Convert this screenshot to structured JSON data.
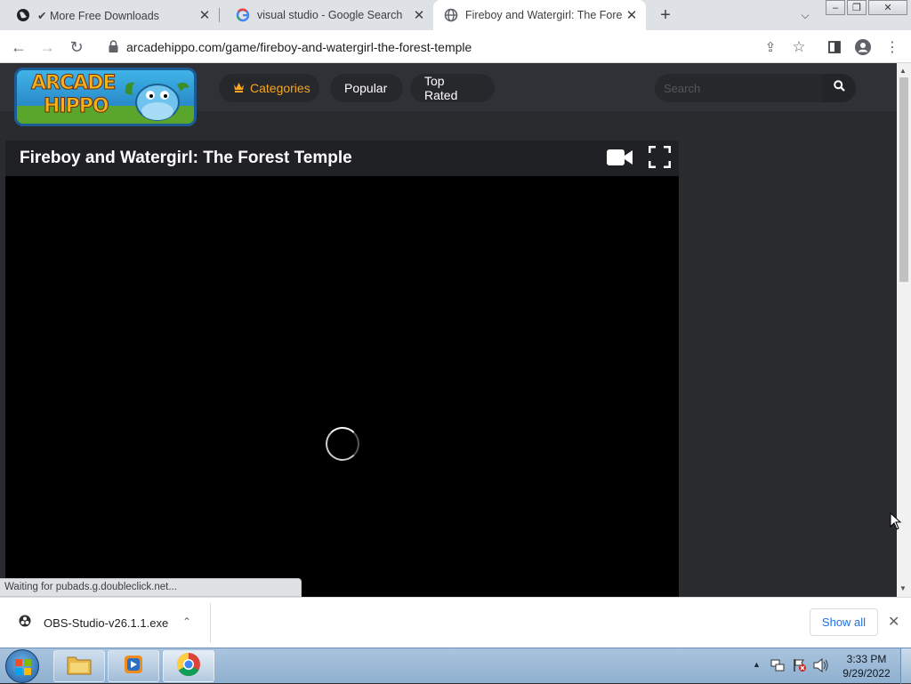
{
  "browser": {
    "tabs": [
      {
        "title": "✔ More Free Downloads",
        "favicon": "world-icon",
        "active": false
      },
      {
        "title": "visual studio - Google Search",
        "favicon": "google-g-icon",
        "active": false
      },
      {
        "title": "Fireboy and Watergirl: The Forest Temple",
        "favicon": "globe-icon",
        "active": true
      }
    ],
    "address": "arcadehippo.com/game/fireboy-and-watergirl-the-forest-temple"
  },
  "site": {
    "logo_line1": "ARCADE",
    "logo_line2": "HIPPO",
    "nav": {
      "categories": "Categories",
      "popular": "Popular",
      "top_rated": "Top Rated"
    },
    "search_placeholder": "Search"
  },
  "game": {
    "title": "Fireboy and Watergirl: The Forest Temple"
  },
  "status_text": "Waiting for pubads.g.doubleclick.net...",
  "download": {
    "file_name": "OBS-Studio-v26.1.1.exe",
    "show_all": "Show all"
  },
  "clock": {
    "time": "3:33 PM",
    "date": "9/29/2022"
  },
  "colors": {
    "accent_orange": "#f5a623",
    "header_bg": "#303136",
    "page_bg": "#2a2b2f",
    "link_blue": "#1a73e8"
  }
}
